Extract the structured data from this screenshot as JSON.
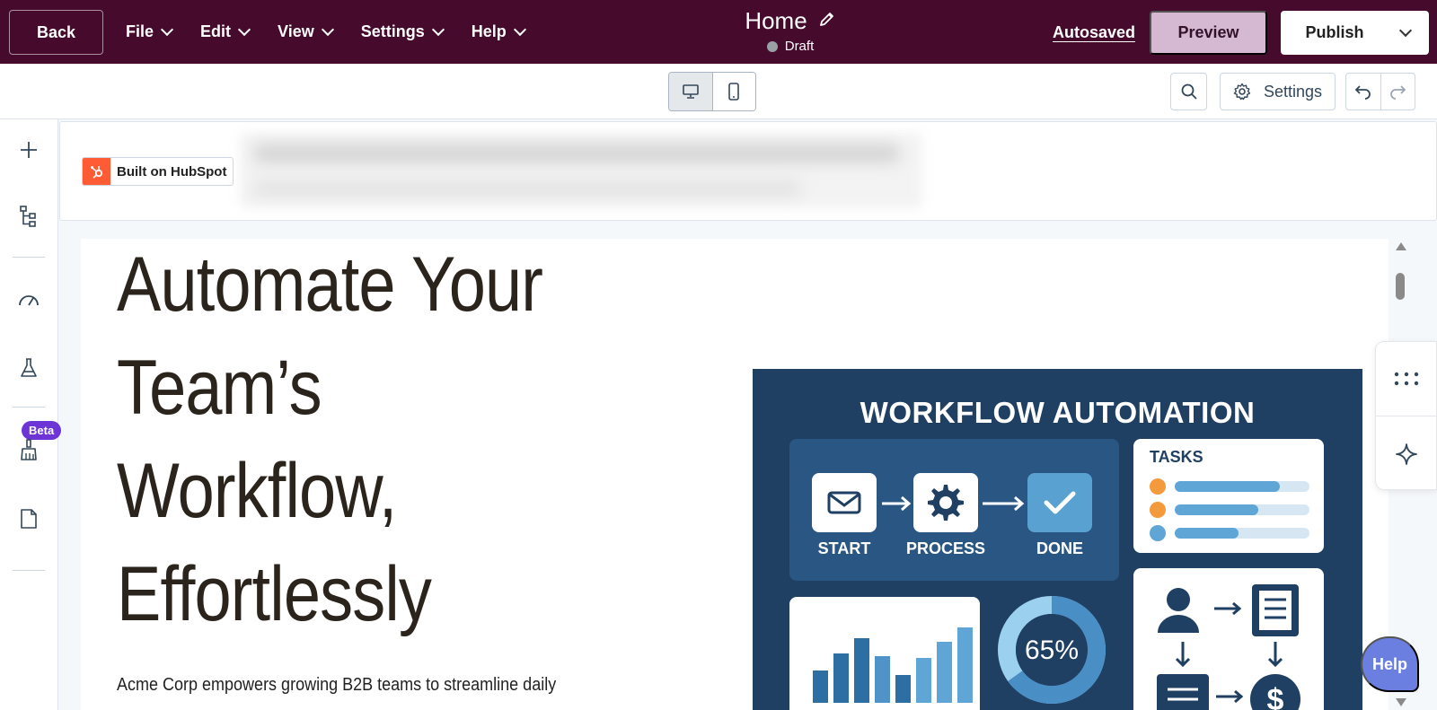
{
  "topbar": {
    "back_label": "Back",
    "menu": [
      {
        "label": "File"
      },
      {
        "label": "Edit"
      },
      {
        "label": "View"
      },
      {
        "label": "Settings"
      },
      {
        "label": "Help"
      }
    ],
    "page_title": "Home",
    "status": "Draft",
    "autosaved_label": "Autosaved",
    "preview_label": "Preview",
    "publish_label": "Publish"
  },
  "toolbar": {
    "settings_label": "Settings"
  },
  "sidebar": {
    "beta_label": "Beta"
  },
  "header_preview": {
    "badge_label": "Built on HubSpot"
  },
  "hero": {
    "title_lines": [
      "Automate Your",
      "Team’s",
      "Workflow,",
      "Effortlessly"
    ],
    "subtitle": "Acme Corp empowers growing B2B teams to streamline daily"
  },
  "illustration": {
    "title": "WORKFLOW AUTOMATION",
    "steps": [
      "START",
      "PROCESS",
      "DONE"
    ],
    "tasks_title": "TASKS",
    "tasks": [
      {
        "color": "#f39a3d",
        "progress": 0.78
      },
      {
        "color": "#f39a3d",
        "progress": 0.62
      },
      {
        "color": "#5fa6d6",
        "progress": 0.47
      }
    ],
    "bars": [
      0.38,
      0.58,
      0.76,
      0.55,
      0.33,
      0.53,
      0.72,
      0.88
    ],
    "bar_colors": [
      "#2d6ea3",
      "#2d6ea3",
      "#2d6ea3",
      "#4f93c9",
      "#2d6ea3",
      "#5fa6d6",
      "#5fa6d6",
      "#5fa6d6"
    ],
    "donut_percent": "65%",
    "donut_value": 0.65
  },
  "floating": {
    "help_label": "Help"
  },
  "colors": {
    "topbar_bg": "#450a2c",
    "preview_bg": "#d5b8d2",
    "beta_bg": "#6d35d6",
    "hubspot_orange": "#ff5c35",
    "help_bg": "#6a7fe0"
  }
}
